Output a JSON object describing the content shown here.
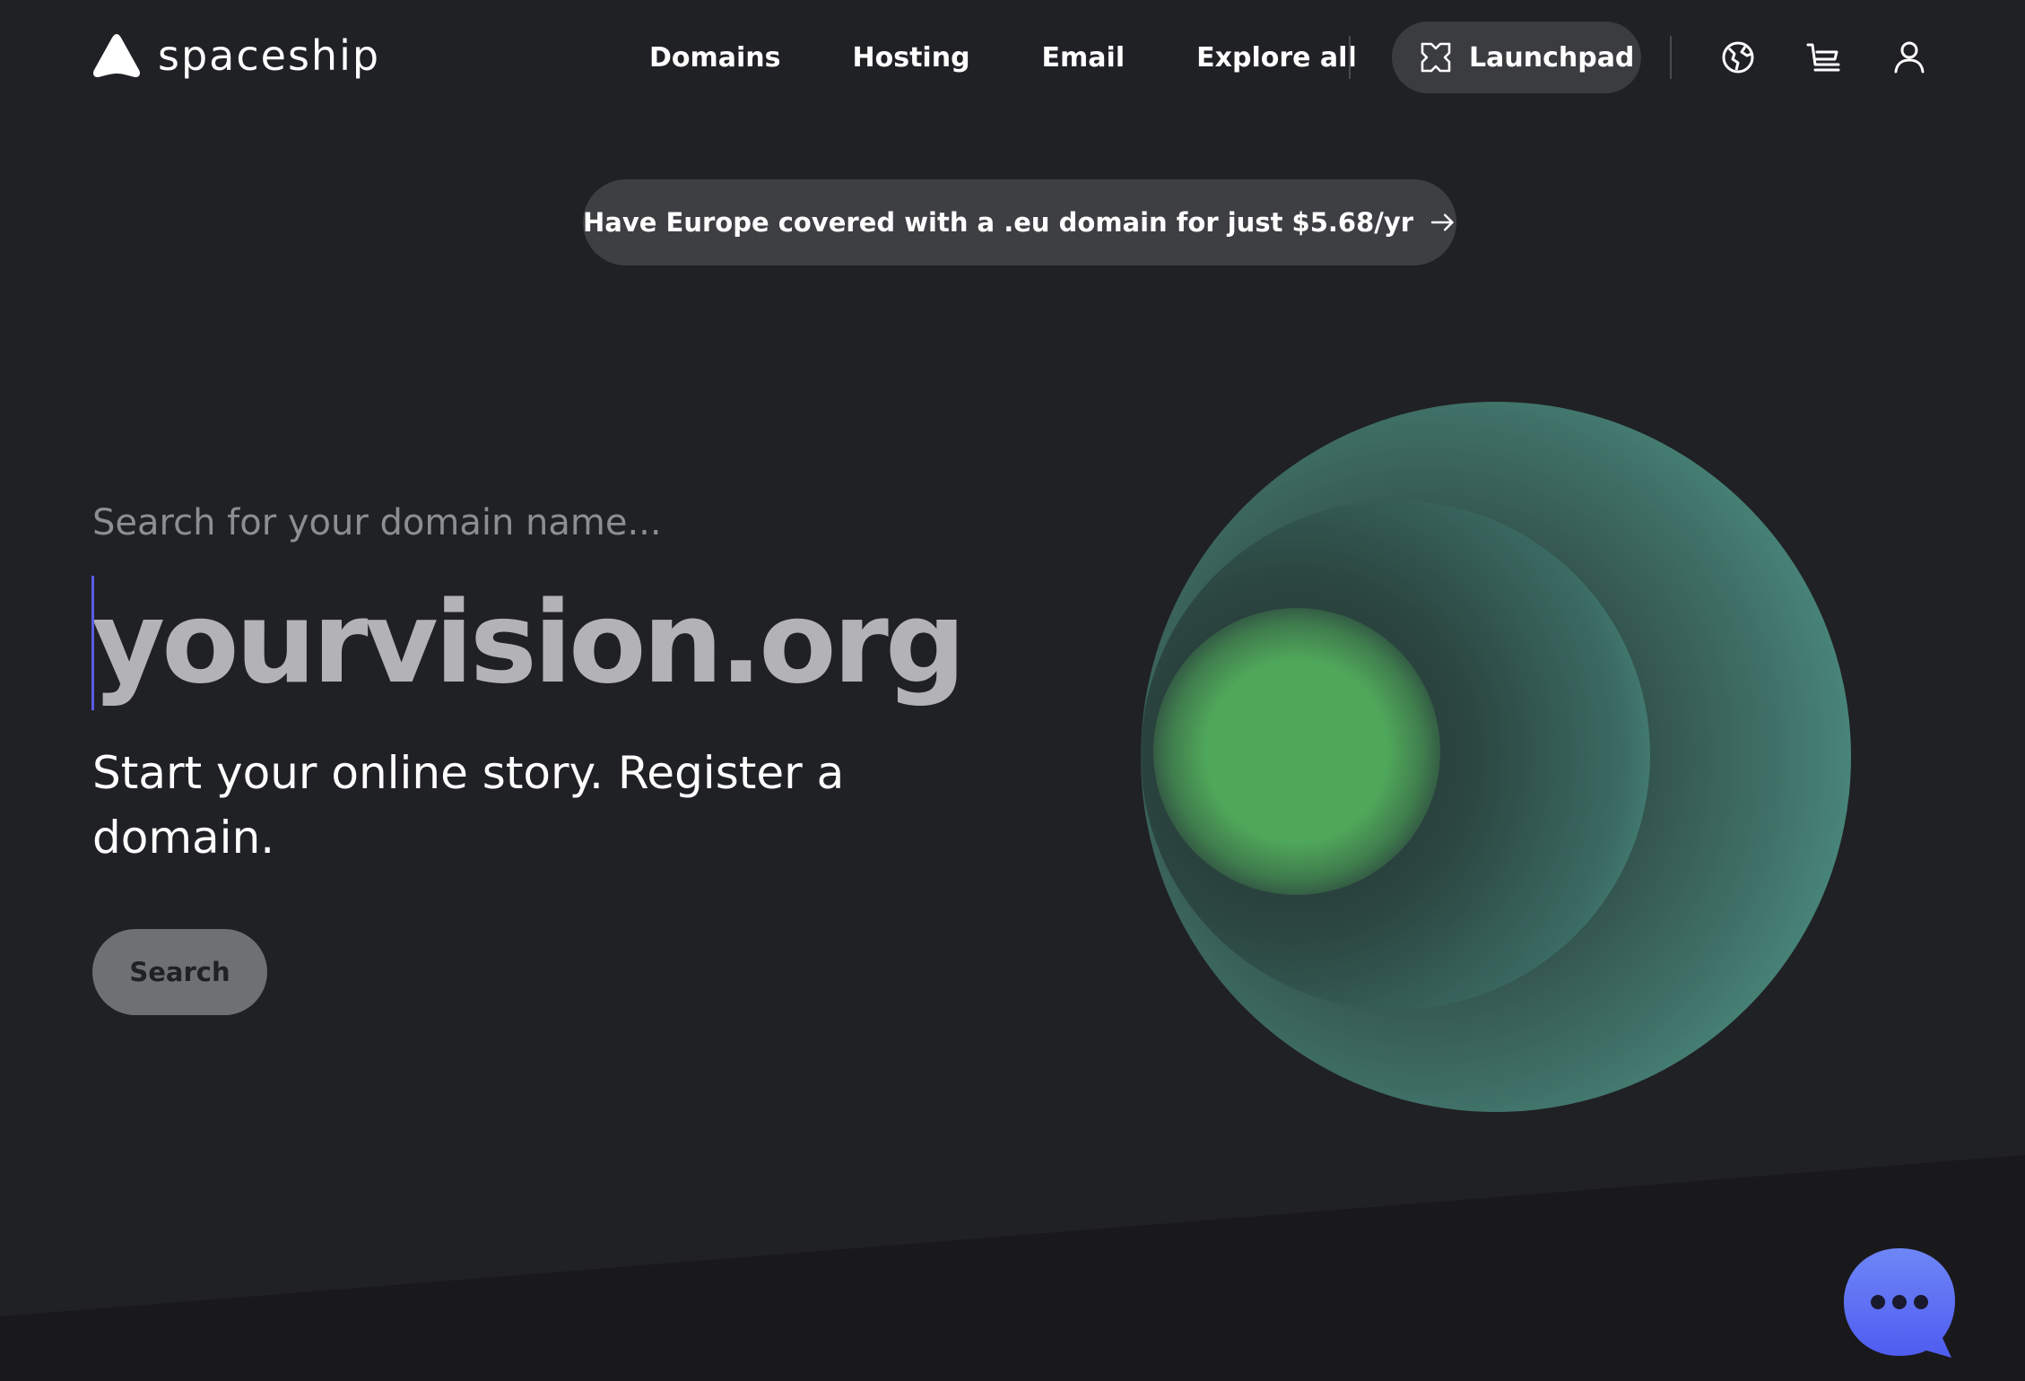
{
  "brand": {
    "name": "spaceship",
    "logo_icon": "spaceship-logo-icon"
  },
  "nav": {
    "links": [
      {
        "label": "Domains"
      },
      {
        "label": "Hosting"
      },
      {
        "label": "Email"
      },
      {
        "label": "Explore all"
      }
    ],
    "launchpad": {
      "label": "Launchpad",
      "icon": "launchpad-icon"
    },
    "icons": [
      "globe-icon",
      "cart-icon",
      "user-icon"
    ]
  },
  "promo": {
    "text": "Have Europe covered with a .eu domain for just $5.68/yr",
    "icon": "arrow-right-icon"
  },
  "hero": {
    "search_label": "Search for your domain name...",
    "domain_placeholder": "yourvision.org",
    "domain_value": "",
    "tagline": "Start your online story. Register a domain.",
    "search_button": "Search"
  },
  "chat": {
    "icon": "chat-bubble-icon"
  },
  "colors": {
    "background": "#202124",
    "pill": "#3e3f42",
    "search_button": "#6f7073",
    "orb_teal": "#56a597",
    "orb_green": "#4fa75a",
    "chat_blue": "#5b6cf0"
  }
}
